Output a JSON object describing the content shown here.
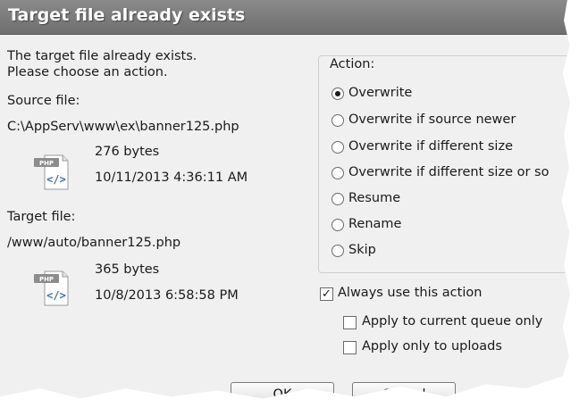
{
  "dialog": {
    "title": "Target file already exists",
    "message_line1": "The target file already exists.",
    "message_line2": "Please choose an action."
  },
  "source": {
    "label": "Source file:",
    "path": "C:\\AppServ\\www\\ex\\banner125.php",
    "size": "276 bytes",
    "modified": "10/11/2013 4:36:11 AM",
    "icon": "php-file-icon",
    "icon_badge": "PHP",
    "icon_glyph": "</>"
  },
  "target": {
    "label": "Target file:",
    "path": "/www/auto/banner125.php",
    "size": "365 bytes",
    "modified": "10/8/2013 6:58:58 PM",
    "icon": "php-file-icon",
    "icon_badge": "PHP",
    "icon_glyph": "</>"
  },
  "action": {
    "legend": "Action:",
    "options": [
      "Overwrite",
      "Overwrite if source newer",
      "Overwrite if different size",
      "Overwrite if different size or so",
      "Resume",
      "Rename",
      "Skip"
    ],
    "selected_index": 0
  },
  "checkboxes": {
    "always_use": {
      "label": "Always use this action",
      "checked": true
    },
    "current_queue": {
      "label": "Apply to current queue only",
      "checked": false
    },
    "uploads_only": {
      "label": "Apply only to uploads",
      "checked": false
    }
  },
  "buttons": {
    "ok": "OK",
    "cancel": "Cancel"
  },
  "colors": {
    "title_bar": "#7d7d7d",
    "dialog_bg": "#f0f0f0",
    "icon_badge": "#8c8c8c",
    "icon_glyph": "#3a6fb0"
  }
}
